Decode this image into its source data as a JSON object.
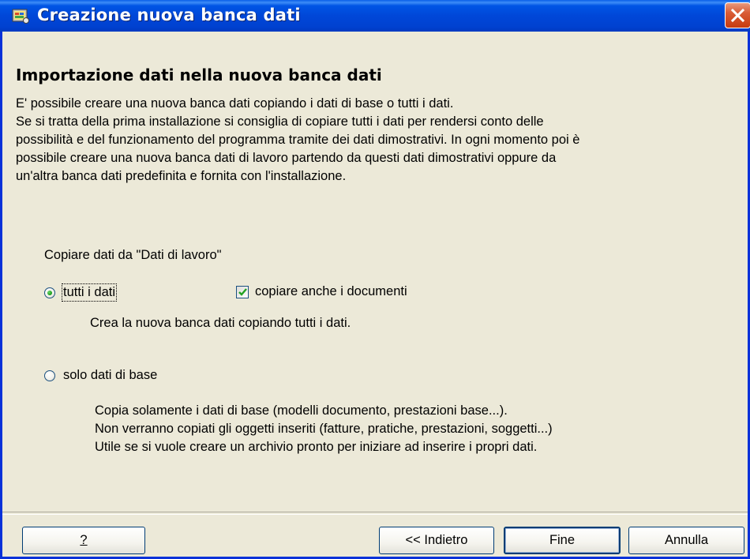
{
  "window": {
    "title": "Creazione nuova banca dati"
  },
  "content": {
    "heading": "Importazione dati nella nuova banca dati",
    "description_lines": [
      "E' possibile creare una nuova banca dati copiando i dati di base o tutti i dati.",
      "Se si tratta della prima installazione si consiglia di copiare tutti i dati per rendersi conto delle",
      "possibilità e del funzionamento del programma tramite dei dati dimostrativi. In ogni momento poi è",
      "possibile creare una nuova banca dati di lavoro partendo da questi dati dimostrativi oppure da",
      "un'altra banca dati predefinita e fornita con l'installazione."
    ],
    "group_label": "Copiare dati da \"Dati di lavoro\"",
    "option_all": {
      "label": "tutti i dati",
      "selected": true,
      "description": "Crea la nuova banca dati copiando tutti i dati."
    },
    "copy_documents": {
      "label": "copiare anche i documenti",
      "checked": true
    },
    "option_base": {
      "label": "solo dati di base",
      "selected": false,
      "description_lines": [
        "Copia solamente i dati di base (modelli documento, prestazioni base...).",
        "Non verranno copiati gli oggetti inseriti (fatture, pratiche, prestazioni, soggetti...)",
        "Utile se si vuole creare un archivio pronto per iniziare ad inserire i propri dati."
      ]
    }
  },
  "buttons": {
    "help": "?",
    "back": "<< Indietro",
    "finish": "Fine",
    "cancel": "Annulla"
  },
  "colors": {
    "titlebar": "#0047D8",
    "face": "#ECE9D8",
    "close": "#C73B0F"
  }
}
